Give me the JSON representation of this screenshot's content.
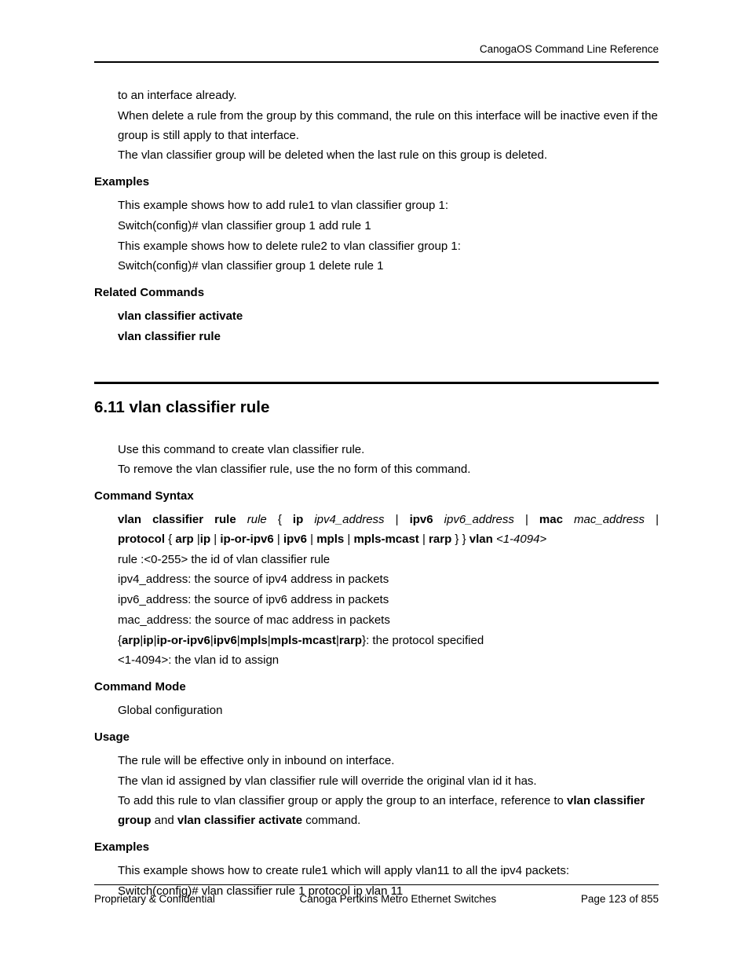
{
  "header": {
    "doc_title": "CanogaOS Command Line Reference"
  },
  "top": {
    "p1": "to an interface already.",
    "p2": "When delete a rule from the group by this command, the rule on this interface will be inactive even if the group is still apply to that interface.",
    "p3": "The vlan classifier group will be deleted when the last rule on this group is deleted.",
    "examples_h": "Examples",
    "ex1": "This example shows how to add rule1 to vlan classifier group 1:",
    "ex2": "Switch(config)# vlan classifier group 1 add rule 1",
    "ex3": "This example shows how to delete rule2 to vlan classifier group 1:",
    "ex4": "Switch(config)# vlan classifier group 1 delete rule 1",
    "related_h": "Related Commands",
    "rc1": "vlan classifier activate",
    "rc2": "vlan classifier rule"
  },
  "section": {
    "title": "6.11 vlan classifier rule",
    "p1": "Use this command to create vlan classifier rule.",
    "p2": "To remove the vlan classifier rule, use the no form of this command.",
    "syntax_h": "Command Syntax",
    "syn": {
      "l1_b1": "vlan classifier rule",
      "l1_i1": "rule",
      "l1_t1": "{",
      "l1_b2": "ip",
      "l1_i2": "ipv4_address",
      "l1_t2": "|",
      "l1_b3": "ipv6",
      "l1_i3": "ipv6_address",
      "l1_t3": "|",
      "l1_b4": "mac",
      "l1_i4": "mac_address",
      "l1_t4": "|",
      "l2_b1": "protocol",
      "l2_t1": " { ",
      "l2_b2": "arp",
      "l2_t2": " |",
      "l2_b3": "ip",
      "l2_t3": " | ",
      "l2_b4": "ip-or-ipv6",
      "l2_t4": " | ",
      "l2_b5": "ipv6",
      "l2_t5": " | ",
      "l2_b6": "mpls",
      "l2_t6": " | ",
      "l2_b7": "mpls-mcast",
      "l2_t7": " | ",
      "l2_b8": "rarp",
      "l2_t8": " } } ",
      "l2_b9": "vlan",
      "l2_t9": " ",
      "l2_i1": "<1-4094>"
    },
    "d1": "rule :<0-255> the id of vlan classifier rule",
    "d2": "ipv4_address: the source of ipv4 address in packets",
    "d3": "ipv6_address: the source of ipv6 address in packets",
    "d4": "mac_address: the source of mac address in packets",
    "d5a": "{",
    "d5b": "arp",
    "d5c": "|",
    "d5d": "ip",
    "d5e": "|",
    "d5f": "ip-or-ipv6",
    "d5g": "|",
    "d5h": "ipv6",
    "d5i": "|",
    "d5j": "mpls",
    "d5k": "|",
    "d5l": "mpls-mcast",
    "d5m": "|",
    "d5n": "rarp",
    "d5o": "}: the protocol specified",
    "d6": "<1-4094>: the vlan id to assign",
    "mode_h": "Command Mode",
    "mode_v": "Global configuration",
    "usage_h": "Usage",
    "u1": "The rule will be effective only in inbound on interface.",
    "u2": "The vlan id assigned by vlan classifier rule will override the original vlan id it has.",
    "u3a": "To add this rule to vlan classifier group or apply the group to an interface, reference to ",
    "u3b": "vlan classifier group",
    "u3c": " and ",
    "u3d": "vlan classifier activate",
    "u3e": " command.",
    "examples_h": "Examples",
    "ex1": "This example shows how to create rule1 which will apply vlan11 to all the ipv4 packets:",
    "ex2": "Switch(config)# vlan classifier rule 1 protocol ip vlan 11"
  },
  "footer": {
    "left": "Proprietary & Confidential",
    "center": "Canoga Pertkins Metro Ethernet Switches",
    "right": "Page 123 of 855"
  }
}
